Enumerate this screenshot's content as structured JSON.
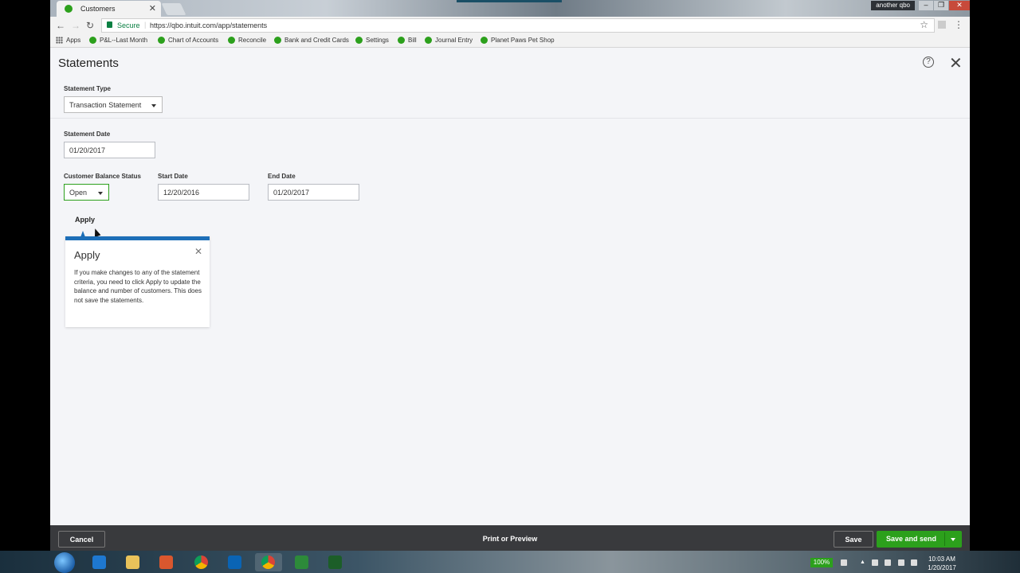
{
  "browser": {
    "tab_title": "Customers",
    "tab_close": "✕",
    "profile_label": "another qbo",
    "minimize": "–",
    "restore": "❐",
    "close": "✕",
    "back": "←",
    "forward": "→",
    "reload": "↻",
    "secure_label": "Secure",
    "url": "https://qbo.intuit.com/app/statements",
    "star": "☆",
    "menu": "⋮",
    "bookmarks": [
      {
        "label": "Apps"
      },
      {
        "label": "P&L--Last Month"
      },
      {
        "label": "Chart of Accounts"
      },
      {
        "label": "Reconcile"
      },
      {
        "label": "Bank and Credit Cards"
      },
      {
        "label": "Settings"
      },
      {
        "label": "Bill"
      },
      {
        "label": "Journal Entry"
      },
      {
        "label": "Planet Paws Pet Shop"
      }
    ]
  },
  "page": {
    "title": "Statements",
    "help": "?",
    "close": "✕",
    "statement_type_label": "Statement Type",
    "statement_type_value": "Transaction Statement",
    "statement_date_label": "Statement Date",
    "statement_date_value": "01/20/2017",
    "balance_status_label": "Customer Balance Status",
    "balance_status_value": "Open",
    "start_date_label": "Start Date",
    "start_date_value": "12/20/2016",
    "end_date_label": "End Date",
    "end_date_value": "01/20/2017",
    "apply_label": "Apply"
  },
  "tooltip": {
    "title": "Apply",
    "close": "✕",
    "body": "If you make changes to any of the statement criteria, you need to click Apply to update the balance and number of customers. This does not save the statements."
  },
  "footer": {
    "cancel": "Cancel",
    "print_preview": "Print or Preview",
    "save": "Save",
    "save_and_send": "Save and send"
  },
  "taskbar": {
    "battery": "100%",
    "time": "10:03 AM",
    "date": "1/20/2017"
  },
  "colors": {
    "qbo_green": "#2ca01c",
    "tooltip_blue": "#1d6fb8",
    "footer_bg": "#393a3d"
  }
}
